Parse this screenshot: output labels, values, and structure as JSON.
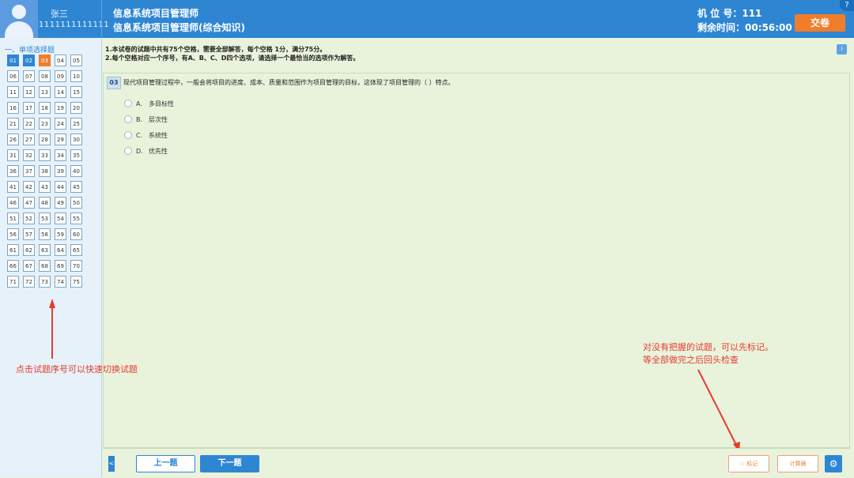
{
  "header": {
    "user_name": "张三",
    "user_id": "1111111111111",
    "exam_title": "信息系统项目管理师",
    "exam_subtitle": "信息系统项目管理师(综合知识)",
    "seat": "机 位 号：111",
    "remaining_time": "剩余时间：00:56:00",
    "submit_label": "交卷",
    "help_label": "?"
  },
  "sidebar": {
    "section_label": "一、单项选择题",
    "questions": [
      "01",
      "02",
      "03",
      "04",
      "05",
      "06",
      "07",
      "08",
      "09",
      "10",
      "11",
      "12",
      "13",
      "14",
      "15",
      "16",
      "17",
      "18",
      "19",
      "20",
      "21",
      "22",
      "23",
      "24",
      "25",
      "26",
      "27",
      "28",
      "29",
      "30",
      "31",
      "32",
      "33",
      "34",
      "35",
      "36",
      "37",
      "38",
      "39",
      "40",
      "41",
      "42",
      "43",
      "44",
      "45",
      "46",
      "47",
      "48",
      "49",
      "50",
      "51",
      "52",
      "53",
      "54",
      "55",
      "56",
      "57",
      "58",
      "59",
      "60",
      "61",
      "62",
      "63",
      "64",
      "65",
      "66",
      "67",
      "68",
      "69",
      "70",
      "71",
      "72",
      "73",
      "74",
      "75"
    ],
    "answered": [
      "01",
      "02"
    ],
    "current": "03"
  },
  "instructions": {
    "line1": "1.本试卷的试题中共有75个空格，需要全部解答，每个空格 1分，满分75分。",
    "line2": "2.每个空格对应一个序号，有A、B、C、D四个选项，请选择一个最恰当的选项作为解答。",
    "info_label": "i"
  },
  "question": {
    "number": "03",
    "text": "现代项目管理过程中，一般会将项目的进度、成本、质量和范围作为项目管理的目标，这体现了项目管理的（    ）特点。",
    "options": [
      {
        "letter": "A.",
        "text": "多目标性"
      },
      {
        "letter": "B.",
        "text": "层次性"
      },
      {
        "letter": "C.",
        "text": "系统性"
      },
      {
        "letter": "D.",
        "text": "优先性"
      }
    ]
  },
  "annotations": {
    "left": "点击试题序号可以快速切换试题",
    "right_line1": "对没有把握的试题，可以先标记。",
    "right_line2": "等全部做完之后回头检查"
  },
  "bottom": {
    "collapse_label": "<",
    "prev_label": "上一题",
    "next_label": "下一题",
    "mark_label": "☆ 标记",
    "calc_label": "计算器",
    "settings_label": "⚙"
  },
  "colors": {
    "primary": "#2e86d3",
    "accent": "#f07d2a",
    "annotation": "#e53b2f"
  }
}
